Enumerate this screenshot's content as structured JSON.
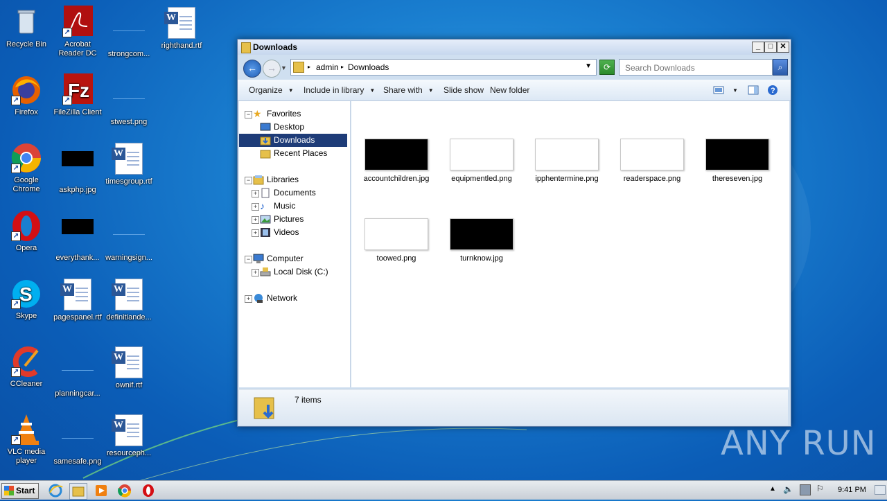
{
  "desktop": {
    "icons": [
      {
        "label": "Recycle Bin"
      },
      {
        "label": "Acrobat Reader DC"
      },
      {
        "label": "strongcom..."
      },
      {
        "label": "righthand.rtf"
      },
      {
        "label": "Firefox"
      },
      {
        "label": "FileZilla Client"
      },
      {
        "label": "stwest.png"
      },
      {
        "label": "Google Chrome"
      },
      {
        "label": "askphp.jpg"
      },
      {
        "label": "timesgroup.rtf"
      },
      {
        "label": "Opera"
      },
      {
        "label": "everythank..."
      },
      {
        "label": "warningsign..."
      },
      {
        "label": "Skype"
      },
      {
        "label": "pagespanel.rtf"
      },
      {
        "label": "definitiande..."
      },
      {
        "label": "CCleaner"
      },
      {
        "label": "planningcar..."
      },
      {
        "label": "ownif.rtf"
      },
      {
        "label": "VLC media player"
      },
      {
        "label": "samesafe.png"
      },
      {
        "label": "resourceph..."
      }
    ]
  },
  "window": {
    "title": "Downloads",
    "breadcrumb": [
      "admin",
      "Downloads"
    ],
    "search_placeholder": "Search Downloads",
    "toolbar": {
      "organize": "Organize",
      "include_in_library": "Include in library",
      "share_with": "Share with",
      "slide_show": "Slide show",
      "new_folder": "New folder"
    },
    "nav": {
      "favorites": "Favorites",
      "desktop": "Desktop",
      "downloads": "Downloads",
      "recent_places": "Recent Places",
      "libraries": "Libraries",
      "documents": "Documents",
      "music": "Music",
      "pictures": "Pictures",
      "videos": "Videos",
      "computer": "Computer",
      "local_disk": "Local Disk (C:)",
      "network": "Network"
    },
    "files": [
      {
        "name": "accountchildren.jpg",
        "thumb": "black"
      },
      {
        "name": "equipmentled.png",
        "thumb": "white"
      },
      {
        "name": "ipphentermine.png",
        "thumb": "white"
      },
      {
        "name": "readerspace.png",
        "thumb": "white"
      },
      {
        "name": "thereseven.jpg",
        "thumb": "black"
      },
      {
        "name": "toowed.png",
        "thumb": "white"
      },
      {
        "name": "turnknow.jpg",
        "thumb": "black"
      }
    ],
    "status": "7 items"
  },
  "taskbar": {
    "start_label": "Start",
    "clock": "9:41 PM"
  },
  "watermark": "ANY RUN",
  "colors": {
    "desktop_bg": "#1a7fd0",
    "selection": "#1e3c78"
  }
}
